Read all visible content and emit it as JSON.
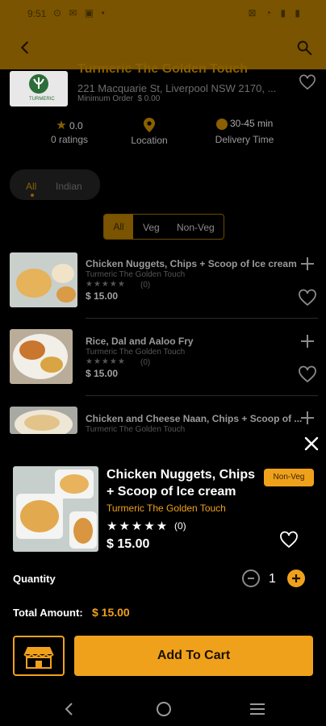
{
  "status": {
    "time": "9:51",
    "left_icons": "⊙ ✉ ▣ •",
    "right_icons": "⊠ ◔ ▮ ▮"
  },
  "appbar": {
    "back_icon": "arrow-left",
    "search_icon": "search"
  },
  "restaurant": {
    "name": "Turmeric The Golden Touch",
    "address": "221 Macquarie St, Liverpool NSW 2170, ...",
    "min_order_label": "Minimum Order",
    "min_order_value": "$ 0.00",
    "logo_text": "TURMERIC",
    "rating": "0.0",
    "ratings_label": "0 ratings",
    "location_label": "Location",
    "delivery_time": "30-45 min",
    "delivery_label": "Delivery Time"
  },
  "category_chips": [
    "All",
    "Indian"
  ],
  "diet_filter": {
    "options": [
      "All",
      "Veg",
      "Non-Veg"
    ],
    "selected": "All"
  },
  "dishes": [
    {
      "title": "Chicken Nuggets, Chips + Scoop of Ice cream",
      "restaurant": "Turmeric The Golden Touch",
      "rating_count": "(0)",
      "price": "$ 15.00"
    },
    {
      "title": "Rice, Dal and Aaloo Fry",
      "restaurant": "Turmeric The Golden Touch",
      "rating_count": "(0)",
      "price": "$ 15.00"
    },
    {
      "title": "Chicken and Cheese Naan, Chips + Scoop of ...",
      "restaurant": "Turmeric The Golden Touch",
      "rating_count": "",
      "price": ""
    }
  ],
  "sheet": {
    "title": "Chicken Nuggets, Chips + Scoop of Ice cream",
    "tag": "Non-Veg",
    "restaurant": "Turmeric The Golden Touch",
    "rating_count": "(0)",
    "price": "$ 15.00",
    "quantity_label": "Quantity",
    "quantity": "1",
    "total_label": "Total Amount:",
    "total_value": "$ 15.00",
    "add_to_cart": "Add To Cart"
  },
  "colors": {
    "accent": "#f0a11c",
    "appbar": "#7a5400",
    "background": "#000000"
  }
}
